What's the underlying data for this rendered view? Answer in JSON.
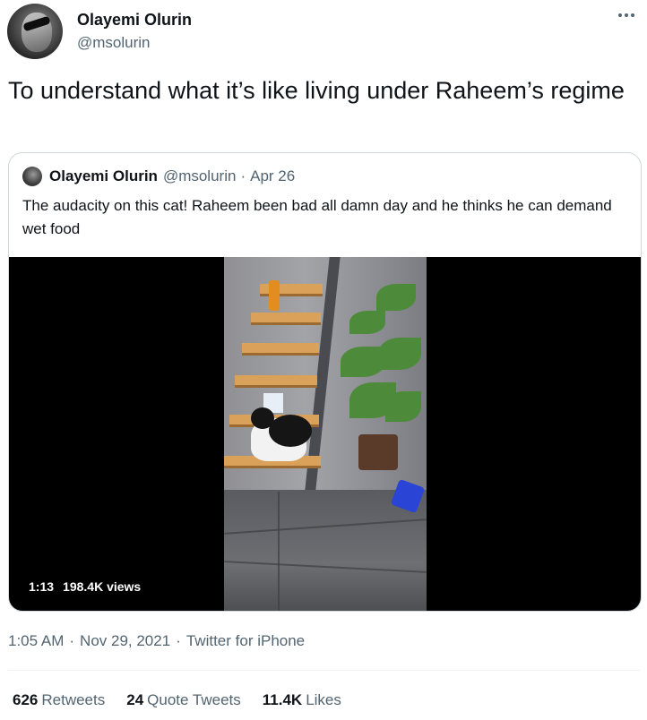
{
  "author": {
    "name": "Olayemi Olurin",
    "handle": "@msolurin"
  },
  "tweet": {
    "text": "To understand what it’s like living under Raheem’s regime"
  },
  "quote": {
    "name": "Olayemi Olurin",
    "handle": "@msolurin",
    "separator": "·",
    "date": "Apr 26",
    "text": "The audacity on this cat! Raheem been bad all damn day and he thinks he can demand wet food",
    "media": {
      "duration": "1:13",
      "views": "198.4K views"
    }
  },
  "meta": {
    "time": "1:05 AM",
    "dot1": "·",
    "date": "Nov 29, 2021",
    "dot2": "·",
    "source": "Twitter for iPhone"
  },
  "stats": [
    {
      "count": "626",
      "label": "Retweets"
    },
    {
      "count": "24",
      "label": "Quote Tweets"
    },
    {
      "count": "11.4K",
      "label": "Likes"
    }
  ],
  "icons": {
    "more": "more-horizontal-icon"
  }
}
